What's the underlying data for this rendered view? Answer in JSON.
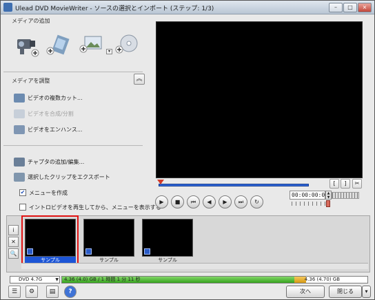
{
  "window": {
    "title": "Ulead DVD MovieWriter - ソースの選択とインポート (ステップ: 1/3)",
    "min_label": "–",
    "max_label": "□",
    "close_label": "×"
  },
  "sidebar": {
    "add_media_label": "メディアの追加",
    "edit_media_label": "メディアを調整",
    "collapse_glyph": "︽",
    "edit_items": [
      {
        "label": "ビデオの複数カット...",
        "enabled": true
      },
      {
        "label": "ビデオを合成/分割",
        "enabled": false
      },
      {
        "label": "ビデオをエンハンス...",
        "enabled": true
      }
    ],
    "chapter_label": "チャプタの追加/編集...",
    "export_label": "選択したクリップをエクスポート",
    "menu_create": {
      "label": "メニューを作成",
      "checked": true
    },
    "intro_video": {
      "label": "イントロビデオを再生してから、メニューを表示する",
      "checked": false
    }
  },
  "player": {
    "timecode": "00:00:00:00",
    "mark_in": "[",
    "mark_out": "]",
    "cut": "✂",
    "controls": [
      "▶",
      "■",
      "⏮",
      "◀",
      "▶",
      "⏭",
      "↻"
    ]
  },
  "clip_tools": [
    "i",
    "✕",
    "🔍"
  ],
  "clips": [
    {
      "label": "サンプル",
      "selected": true
    },
    {
      "label": "サンプル",
      "selected": false
    },
    {
      "label": "サンプル",
      "selected": false
    }
  ],
  "capacity": {
    "disc_type": "DVD 4.7G",
    "used_text": "4.36 (4.0) GB / 1 時間 1 分 11 秒",
    "total_text": "4.36 (4.70) GB",
    "used_fraction": 0.76,
    "warn_fraction": 0.04,
    "used_color": "#35a31c",
    "warn_color": "#d69a14"
  },
  "footer": {
    "next_label": "次へ",
    "close_label": "閉じる",
    "close_arrow": "▾",
    "help_label": "?"
  }
}
